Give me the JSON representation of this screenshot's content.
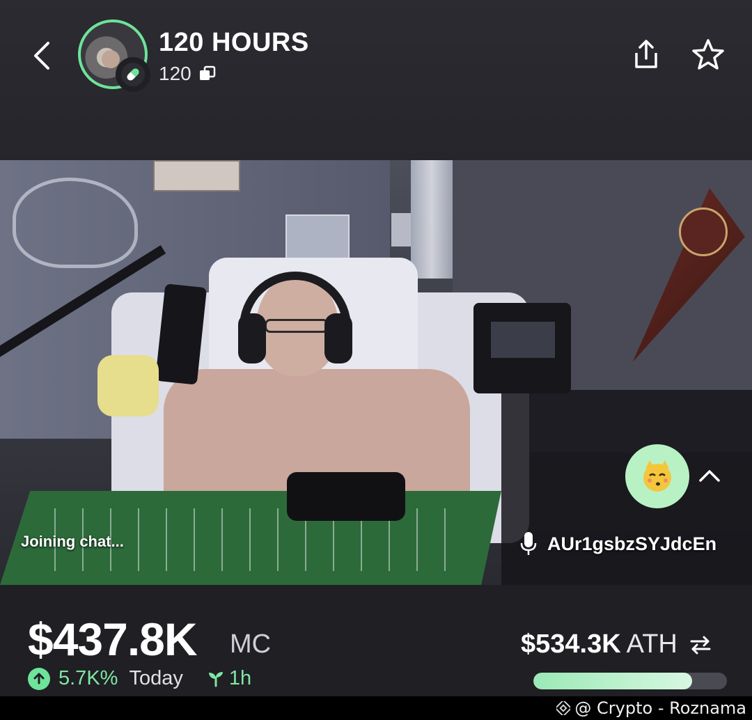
{
  "header": {
    "title": "120 HOURS",
    "holders": "120"
  },
  "video": {
    "status_text": "Joining chat...",
    "speaker_name": "AUr1gsbzSYJdcEn"
  },
  "stats": {
    "market_cap": "$437.8K",
    "market_cap_label": "MC",
    "change_pct": "5.7K%",
    "change_period": "Today",
    "age": "1h",
    "ath_value": "$534.3K",
    "ath_label": "ATH",
    "ath_progress_fraction": 0.82
  },
  "footer": {
    "watermark": "@ Crypto - Roznama"
  },
  "colors": {
    "accent_green": "#6ee39a",
    "background": "#1f1f24",
    "emoji_button_bg": "#b8f2c4"
  },
  "icons": [
    "chevron-left-icon",
    "pill-icon",
    "copy-icon",
    "share-icon",
    "star-icon",
    "mic-icon",
    "emoji-icon",
    "chevron-up-icon",
    "arrow-up-icon",
    "sprout-icon",
    "swap-icon",
    "binance-icon"
  ]
}
